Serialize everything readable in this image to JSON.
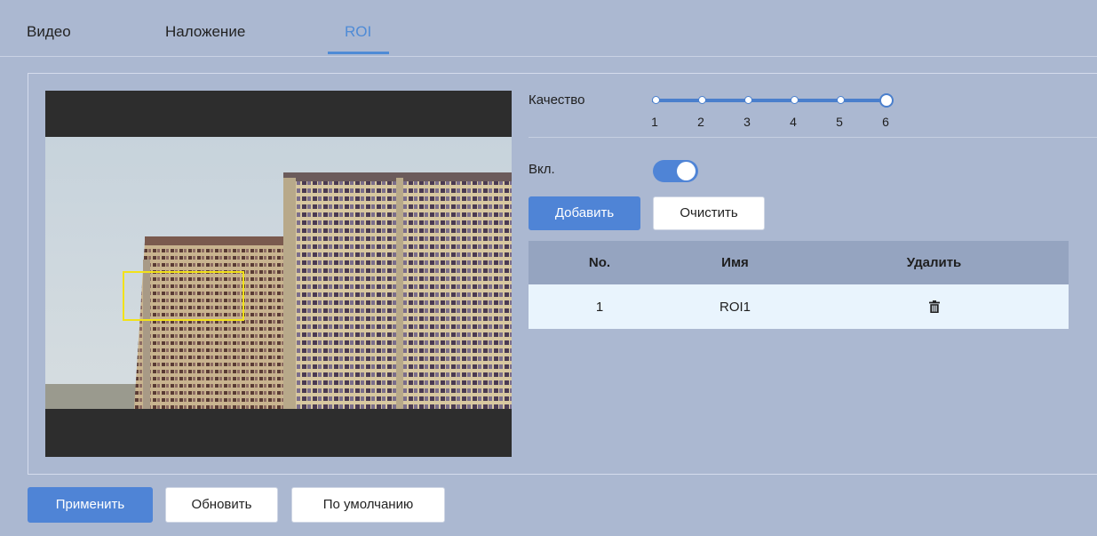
{
  "tabs": [
    {
      "label": "Видео",
      "active": false
    },
    {
      "label": "Наложение",
      "active": false
    },
    {
      "label": "ROI",
      "active": true
    }
  ],
  "quality": {
    "label": "Качество",
    "ticks": [
      "1",
      "2",
      "3",
      "4",
      "5",
      "6"
    ],
    "selected": "6"
  },
  "enable": {
    "label": "Вкл.",
    "on": true
  },
  "roi_buttons": {
    "add": "Добавить",
    "clear": "Очистить"
  },
  "table": {
    "headers": {
      "no": "No.",
      "name": "Имя",
      "delete": "Удалить"
    },
    "rows": [
      {
        "no": "1",
        "name": "ROI1",
        "delete_icon": "trash-icon"
      }
    ]
  },
  "footer": {
    "apply": "Применить",
    "refresh": "Обновить",
    "default": "По умолчанию"
  },
  "colors": {
    "accent": "#4f84d6",
    "background": "#abb8d1",
    "roi_box": "#f2e21a",
    "table_header": "#95a4c0",
    "table_row": "#e9f4fd"
  }
}
